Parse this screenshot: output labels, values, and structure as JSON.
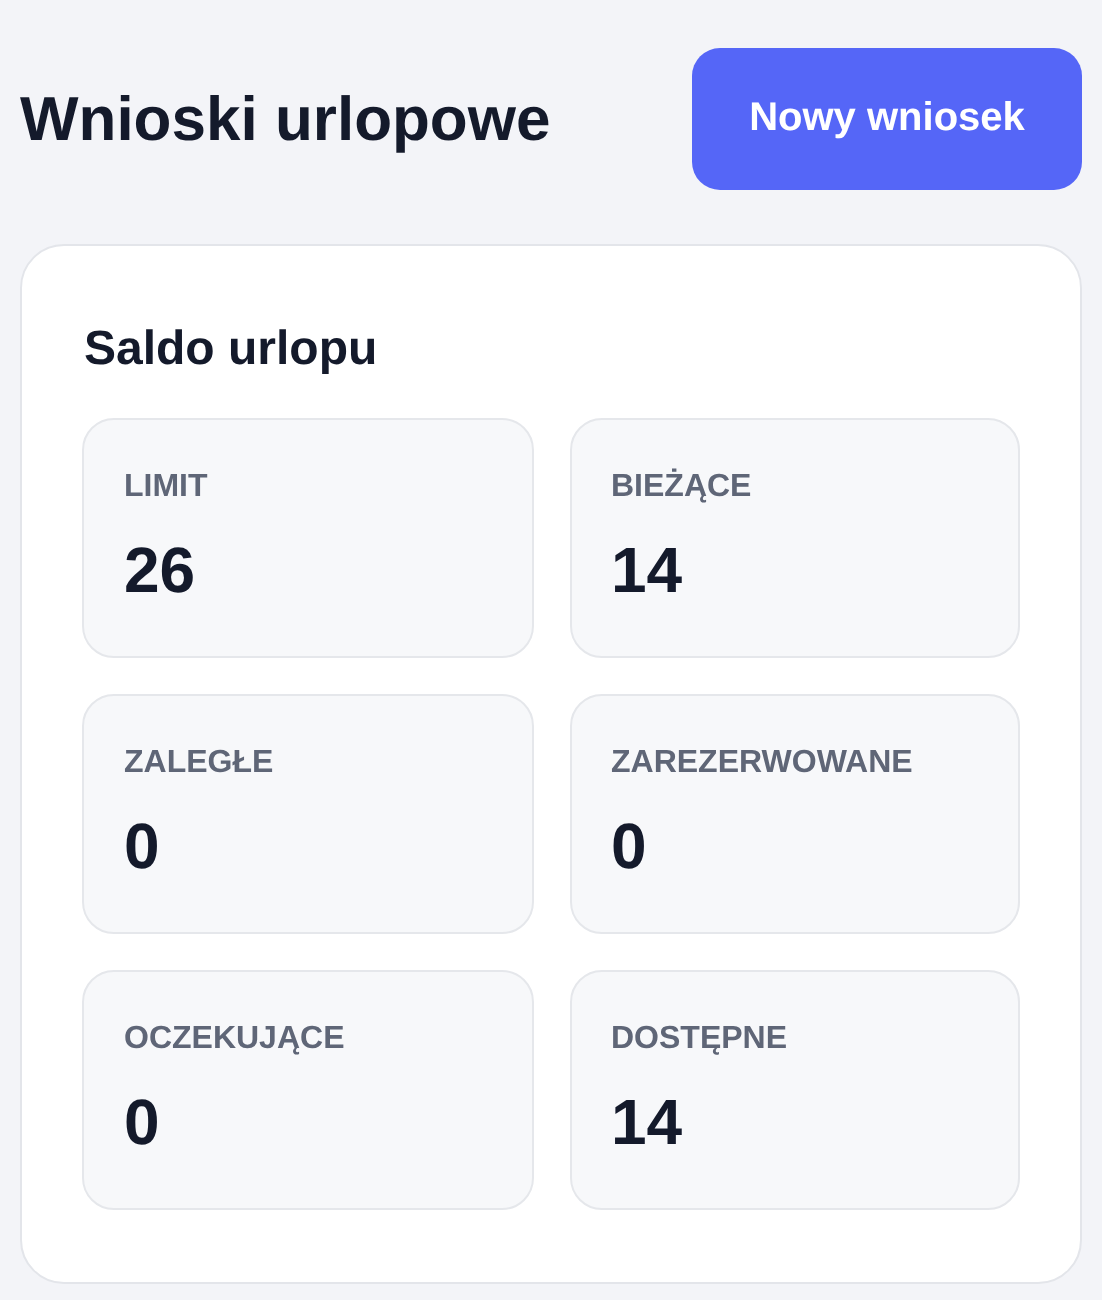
{
  "header": {
    "title": "Wnioski urlopowe",
    "button": "Nowy wniosek"
  },
  "balance": {
    "title": "Saldo urlopu",
    "tiles": [
      {
        "label": "LIMIT",
        "value": "26"
      },
      {
        "label": "BIEŻĄCE",
        "value": "14"
      },
      {
        "label": "ZALEGŁE",
        "value": "0"
      },
      {
        "label": "ZAREZERWOWANE",
        "value": "0"
      },
      {
        "label": "OCZEKUJĄCE",
        "value": "0"
      },
      {
        "label": "DOSTĘPNE",
        "value": "14"
      }
    ]
  }
}
